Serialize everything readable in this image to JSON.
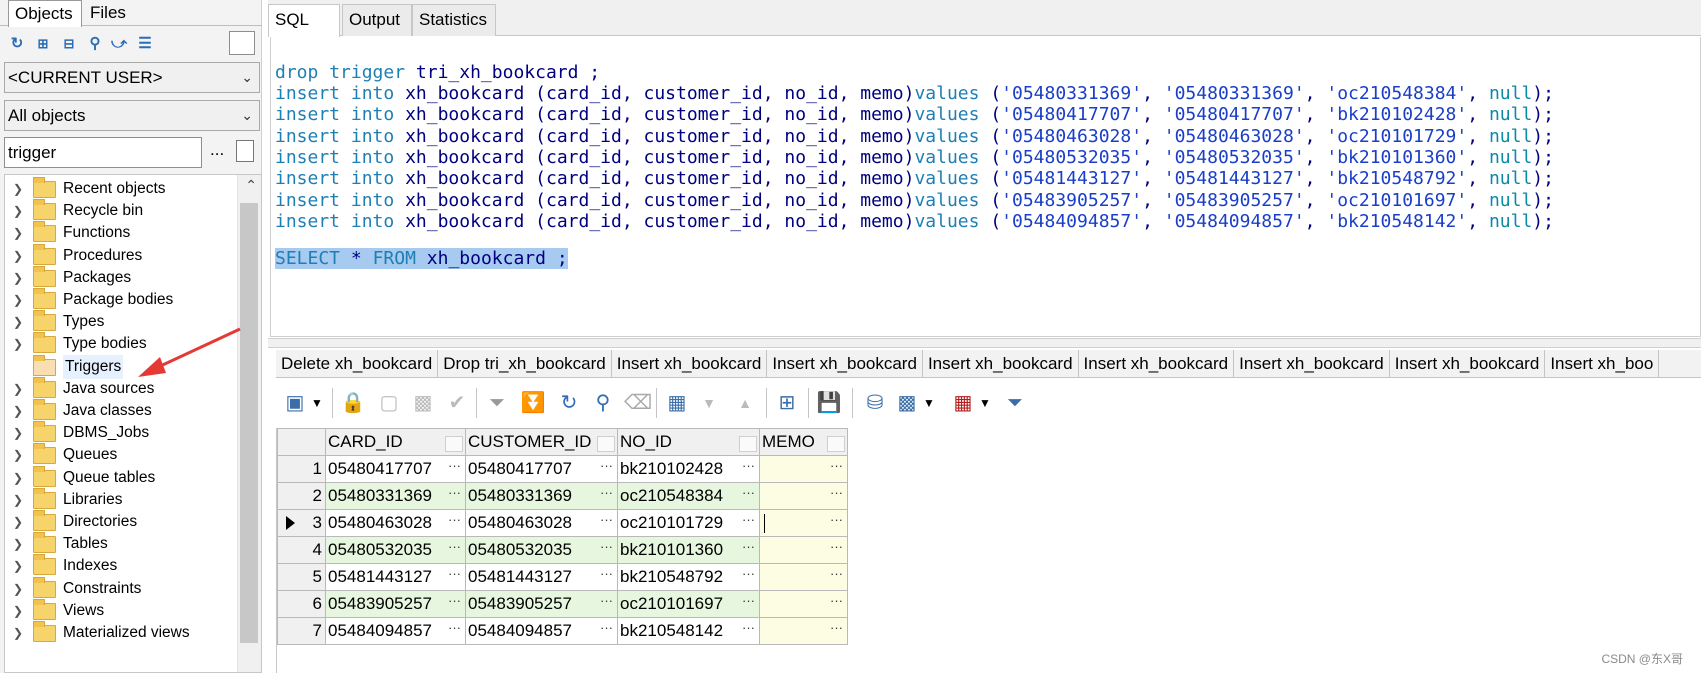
{
  "left_panel": {
    "tabs": [
      "Objects",
      "Files"
    ],
    "toolbar_icons": [
      "refresh-icon",
      "expand-all-icon",
      "collapse-all-icon",
      "find-icon",
      "filter-icon",
      "browser-icon"
    ],
    "user_dropdown": "<CURRENT USER>",
    "objects_dropdown": "All objects",
    "filter_value": "trigger",
    "filter_button": "...",
    "tree_items": [
      "Recent objects",
      "Recycle bin",
      "Functions",
      "Procedures",
      "Packages",
      "Package bodies",
      "Types",
      "Type bodies",
      "Triggers",
      "Java sources",
      "Java classes",
      "DBMS_Jobs",
      "Queues",
      "Queue tables",
      "Libraries",
      "Directories",
      "Tables",
      "Indexes",
      "Constraints",
      "Views",
      "Materialized views"
    ],
    "selected_item": "Triggers"
  },
  "editor_tabs": [
    "SQL",
    "Output",
    "Statistics"
  ],
  "sql": {
    "drop_line": {
      "kw1": "drop",
      "kw2": "trigger",
      "name": "tri_xh_bookcard",
      "end": " ;"
    },
    "insert_rows": [
      [
        "05480331369",
        "05480331369",
        "oc210548384"
      ],
      [
        "05480417707",
        "05480417707",
        "bk210102428"
      ],
      [
        "05480463028",
        "05480463028",
        "oc210101729"
      ],
      [
        "05480532035",
        "05480532035",
        "bk210101360"
      ],
      [
        "05481443127",
        "05481443127",
        "bk210548792"
      ],
      [
        "05483905257",
        "05483905257",
        "oc210101697"
      ],
      [
        "05484094857",
        "05484094857",
        "bk210548142"
      ]
    ],
    "insert_kw": "insert",
    "into_kw": "into",
    "table": "xh_bookcard",
    "columns": "(card_id, customer_id, no_id, memo)",
    "values_kw": "values",
    "null_kw": "null",
    "select_line": {
      "select": "SELECT",
      "star": "*",
      "from": "FROM",
      "table": "xh_bookcard",
      "end": ";"
    }
  },
  "result_tabs": [
    "Delete xh_bookcard",
    "Drop tri_xh_bookcard",
    "Insert xh_bookcard",
    "Insert xh_bookcard",
    "Insert xh_bookcard",
    "Insert xh_bookcard",
    "Insert xh_bookcard",
    "Insert xh_bookcard",
    "Insert xh_boo"
  ],
  "grid": {
    "columns": [
      "CARD_ID",
      "CUSTOMER_ID",
      "NO_ID",
      "MEMO"
    ],
    "rows": [
      {
        "n": "1",
        "card_id": "05480417707",
        "customer_id": "05480417707",
        "no_id": "bk210102428",
        "memo": ""
      },
      {
        "n": "2",
        "card_id": "05480331369",
        "customer_id": "05480331369",
        "no_id": "oc210548384",
        "memo": ""
      },
      {
        "n": "3",
        "card_id": "05480463028",
        "customer_id": "05480463028",
        "no_id": "oc210101729",
        "memo": ""
      },
      {
        "n": "4",
        "card_id": "05480532035",
        "customer_id": "05480532035",
        "no_id": "bk210101360",
        "memo": ""
      },
      {
        "n": "5",
        "card_id": "05481443127",
        "customer_id": "05481443127",
        "no_id": "bk210548792",
        "memo": ""
      },
      {
        "n": "6",
        "card_id": "05483905257",
        "customer_id": "05483905257",
        "no_id": "oc210101697",
        "memo": ""
      },
      {
        "n": "7",
        "card_id": "05484094857",
        "customer_id": "05484094857",
        "no_id": "bk210548142",
        "memo": ""
      }
    ],
    "current_row": 3,
    "cell_button": "···"
  },
  "watermark": "CSDN @东X哥",
  "colors": {
    "keyword": "#1e7fb4",
    "string": "#1a3ec8",
    "selection": "#a6caf0",
    "even_row": "#e6f6df",
    "memo_cell": "#fcfde3",
    "arrow": "#e53935"
  }
}
